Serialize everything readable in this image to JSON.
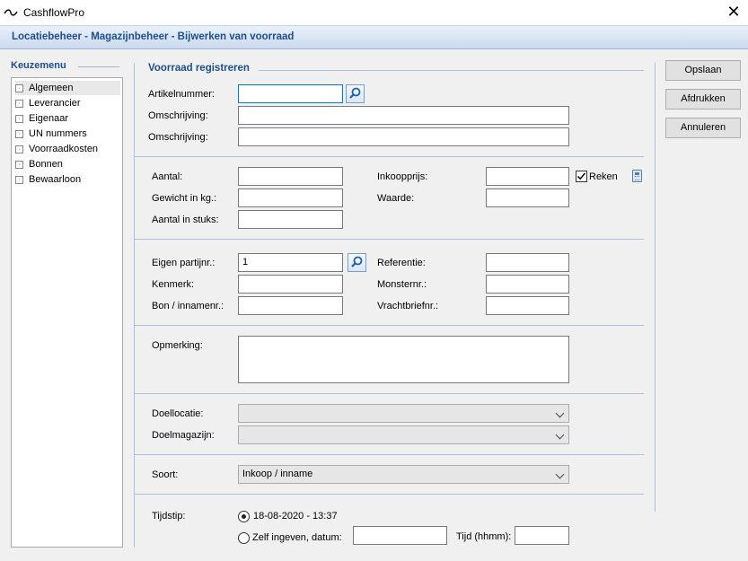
{
  "window": {
    "title": "CashflowPro",
    "close_symbol": "✕"
  },
  "header": {
    "title": "Locatiebeheer - Magazijnbeheer - Bijwerken van voorraad"
  },
  "menu": {
    "label": "Keuzemenu",
    "items": [
      {
        "label": "Algemeen"
      },
      {
        "label": "Leverancier"
      },
      {
        "label": "Eigenaar"
      },
      {
        "label": "UN nummers"
      },
      {
        "label": "Voorraadkosten"
      },
      {
        "label": "Bonnen"
      },
      {
        "label": "Bewaarloon"
      }
    ]
  },
  "section": {
    "title": "Voorraad registreren"
  },
  "form": {
    "artikelnummer": {
      "label": "Artikelnummer:",
      "value": ""
    },
    "omschrijving1": {
      "label": "Omschrijving:",
      "value": ""
    },
    "omschrijving2": {
      "label": "Omschrijving:",
      "value": ""
    },
    "aantal": {
      "label": "Aantal:",
      "value": ""
    },
    "gewicht": {
      "label": "Gewicht in kg.:",
      "value": ""
    },
    "aantal_stuks": {
      "label": "Aantal in stuks:",
      "value": ""
    },
    "inkoopprijs": {
      "label": "Inkoopprijs:",
      "value": ""
    },
    "reken": {
      "label": "Reken",
      "checked": true
    },
    "waarde": {
      "label": "Waarde:",
      "value": ""
    },
    "eigen_partijnr": {
      "label": "Eigen partijnr.:",
      "value": "1"
    },
    "kenmerk": {
      "label": "Kenmerk:",
      "value": ""
    },
    "bon_innamenr": {
      "label": "Bon / innamenr.:",
      "value": ""
    },
    "referentie": {
      "label": "Referentie:",
      "value": ""
    },
    "monsternr": {
      "label": "Monsternr.:",
      "value": ""
    },
    "vrachtbriefnr": {
      "label": "Vrachtbriefnr.:",
      "value": ""
    },
    "opmerking": {
      "label": "Opmerking:",
      "value": ""
    },
    "doellocatie": {
      "label": "Doellocatie:",
      "value": ""
    },
    "doelmagazijn": {
      "label": "Doelmagazijn:",
      "value": ""
    },
    "soort": {
      "label": "Soort:",
      "value": "Inkoop / inname"
    },
    "tijdstip": {
      "label": "Tijdstip:",
      "option_now": "18-08-2020 - 13:37",
      "option_custom": "Zelf ingeven, datum:",
      "tijd_label": "Tijd (hhmm):",
      "selected": "now"
    }
  },
  "buttons": {
    "save": "Opslaan",
    "print": "Afdrukken",
    "cancel": "Annuleren"
  },
  "colors": {
    "accent": "#1f4e8c",
    "header_bg": "#c9d9ef",
    "focus": "#0078d7"
  }
}
